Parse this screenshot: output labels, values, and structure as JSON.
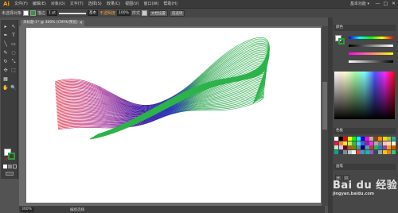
{
  "app": {
    "logo": "Ai",
    "menu": [
      "文件(F)",
      "编辑(E)",
      "对象(O)",
      "文字(T)",
      "选择(S)",
      "效果(C)",
      "视图(V)",
      "窗口(W)",
      "帮助(H)"
    ],
    "workspace": "基本功能 ▾",
    "window_buttons": [
      "—",
      "□",
      "✕"
    ]
  },
  "controlbar": {
    "selection_label": "未选择对象",
    "stroke_label": "描边",
    "stroke_value": "1 pt",
    "brush_label": "基本",
    "opacity_label": "不透明度",
    "opacity_value": "100%",
    "style_label": "样式",
    "doc_setup_btn": "文档设置",
    "prefs_btn": "首选项"
  },
  "document": {
    "tab_title": "未标题-1* @ 300% (CMYK/预览)",
    "close": "✕"
  },
  "tools": [
    "▸",
    "↖",
    "✒",
    "T",
    "╲",
    "▭",
    "✎",
    "◌",
    "↻",
    "⤡",
    "✣",
    "⬚",
    "▦",
    "✋",
    "🔍"
  ],
  "statusbar": {
    "zoom": "300%",
    "mode": "编组选择"
  },
  "panels": {
    "color_tab": "颜色",
    "swatch_tab": "色板",
    "brush_tab": "画笔",
    "layers_tab": "图层"
  },
  "artwork": {
    "gradient_stops": [
      "#e3162e",
      "#9b1a8e",
      "#3a1fa7",
      "#2333b5",
      "#24a04a",
      "#2db34a"
    ]
  },
  "swatches": [
    "#ffffff",
    "#000000",
    "#ff0000",
    "#ffff00",
    "#00ff00",
    "#00ffff",
    "#0000ff",
    "#ff00ff",
    "#c2b280",
    "#8b4513",
    "#ff8c00",
    "#ffd700",
    "#9acd32",
    "#20b2aa",
    "#e6194b",
    "#f58231",
    "#ffe119",
    "#bfef45",
    "#3cb44b",
    "#42d4f4",
    "#4363d8",
    "#911eb4",
    "#f032e6",
    "#a9a9a9",
    "#808080",
    "#fabed4",
    "#ffd8b1",
    "#fffac8",
    "#aaffc3",
    "#dcbeff",
    "#800000",
    "#9a6324",
    "#808000",
    "#469990",
    "#000075",
    "#469dd8",
    "#c0392b",
    "#27ae60",
    "#2980b9",
    "#8e44ad",
    "#f39c12",
    "#d35400",
    "#16a085",
    "#2c3e50",
    "#7f8c8d",
    "#bdc3c7",
    "#ecf0f1",
    "#e74c3c",
    "#3498db",
    "#1abc9c",
    "#9b59b6",
    "#34495e",
    "#95a5a6",
    "#f1c40f",
    "#e67e22",
    "#2ecc71"
  ],
  "watermark": {
    "main": "Bai du 经验",
    "sub": "jingyan.baidu.com"
  }
}
